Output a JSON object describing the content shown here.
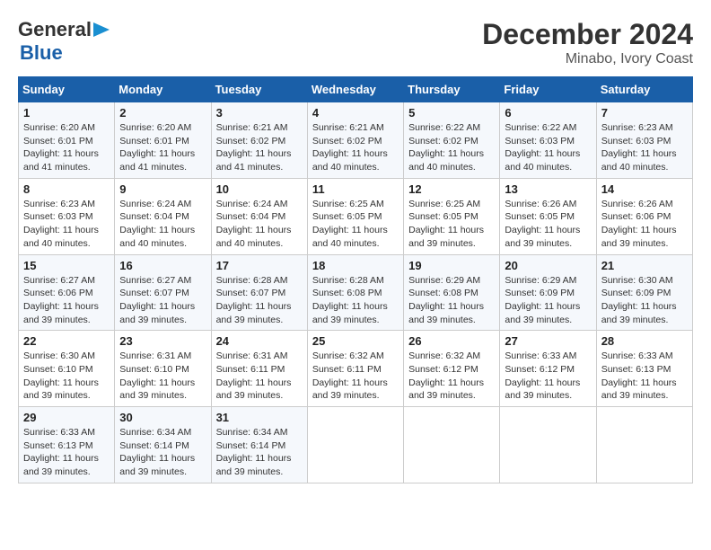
{
  "header": {
    "logo_line1": "General",
    "logo_line2": "Blue",
    "title": "December 2024",
    "subtitle": "Minabo, Ivory Coast"
  },
  "weekdays": [
    "Sunday",
    "Monday",
    "Tuesday",
    "Wednesday",
    "Thursday",
    "Friday",
    "Saturday"
  ],
  "weeks": [
    [
      {
        "day": "1",
        "sunrise": "6:20 AM",
        "sunset": "6:01 PM",
        "daylight": "11 hours and 41 minutes."
      },
      {
        "day": "2",
        "sunrise": "6:20 AM",
        "sunset": "6:01 PM",
        "daylight": "11 hours and 41 minutes."
      },
      {
        "day": "3",
        "sunrise": "6:21 AM",
        "sunset": "6:02 PM",
        "daylight": "11 hours and 41 minutes."
      },
      {
        "day": "4",
        "sunrise": "6:21 AM",
        "sunset": "6:02 PM",
        "daylight": "11 hours and 40 minutes."
      },
      {
        "day": "5",
        "sunrise": "6:22 AM",
        "sunset": "6:02 PM",
        "daylight": "11 hours and 40 minutes."
      },
      {
        "day": "6",
        "sunrise": "6:22 AM",
        "sunset": "6:03 PM",
        "daylight": "11 hours and 40 minutes."
      },
      {
        "day": "7",
        "sunrise": "6:23 AM",
        "sunset": "6:03 PM",
        "daylight": "11 hours and 40 minutes."
      }
    ],
    [
      {
        "day": "8",
        "sunrise": "6:23 AM",
        "sunset": "6:03 PM",
        "daylight": "11 hours and 40 minutes."
      },
      {
        "day": "9",
        "sunrise": "6:24 AM",
        "sunset": "6:04 PM",
        "daylight": "11 hours and 40 minutes."
      },
      {
        "day": "10",
        "sunrise": "6:24 AM",
        "sunset": "6:04 PM",
        "daylight": "11 hours and 40 minutes."
      },
      {
        "day": "11",
        "sunrise": "6:25 AM",
        "sunset": "6:05 PM",
        "daylight": "11 hours and 40 minutes."
      },
      {
        "day": "12",
        "sunrise": "6:25 AM",
        "sunset": "6:05 PM",
        "daylight": "11 hours and 39 minutes."
      },
      {
        "day": "13",
        "sunrise": "6:26 AM",
        "sunset": "6:05 PM",
        "daylight": "11 hours and 39 minutes."
      },
      {
        "day": "14",
        "sunrise": "6:26 AM",
        "sunset": "6:06 PM",
        "daylight": "11 hours and 39 minutes."
      }
    ],
    [
      {
        "day": "15",
        "sunrise": "6:27 AM",
        "sunset": "6:06 PM",
        "daylight": "11 hours and 39 minutes."
      },
      {
        "day": "16",
        "sunrise": "6:27 AM",
        "sunset": "6:07 PM",
        "daylight": "11 hours and 39 minutes."
      },
      {
        "day": "17",
        "sunrise": "6:28 AM",
        "sunset": "6:07 PM",
        "daylight": "11 hours and 39 minutes."
      },
      {
        "day": "18",
        "sunrise": "6:28 AM",
        "sunset": "6:08 PM",
        "daylight": "11 hours and 39 minutes."
      },
      {
        "day": "19",
        "sunrise": "6:29 AM",
        "sunset": "6:08 PM",
        "daylight": "11 hours and 39 minutes."
      },
      {
        "day": "20",
        "sunrise": "6:29 AM",
        "sunset": "6:09 PM",
        "daylight": "11 hours and 39 minutes."
      },
      {
        "day": "21",
        "sunrise": "6:30 AM",
        "sunset": "6:09 PM",
        "daylight": "11 hours and 39 minutes."
      }
    ],
    [
      {
        "day": "22",
        "sunrise": "6:30 AM",
        "sunset": "6:10 PM",
        "daylight": "11 hours and 39 minutes."
      },
      {
        "day": "23",
        "sunrise": "6:31 AM",
        "sunset": "6:10 PM",
        "daylight": "11 hours and 39 minutes."
      },
      {
        "day": "24",
        "sunrise": "6:31 AM",
        "sunset": "6:11 PM",
        "daylight": "11 hours and 39 minutes."
      },
      {
        "day": "25",
        "sunrise": "6:32 AM",
        "sunset": "6:11 PM",
        "daylight": "11 hours and 39 minutes."
      },
      {
        "day": "26",
        "sunrise": "6:32 AM",
        "sunset": "6:12 PM",
        "daylight": "11 hours and 39 minutes."
      },
      {
        "day": "27",
        "sunrise": "6:33 AM",
        "sunset": "6:12 PM",
        "daylight": "11 hours and 39 minutes."
      },
      {
        "day": "28",
        "sunrise": "6:33 AM",
        "sunset": "6:13 PM",
        "daylight": "11 hours and 39 minutes."
      }
    ],
    [
      {
        "day": "29",
        "sunrise": "6:33 AM",
        "sunset": "6:13 PM",
        "daylight": "11 hours and 39 minutes."
      },
      {
        "day": "30",
        "sunrise": "6:34 AM",
        "sunset": "6:14 PM",
        "daylight": "11 hours and 39 minutes."
      },
      {
        "day": "31",
        "sunrise": "6:34 AM",
        "sunset": "6:14 PM",
        "daylight": "11 hours and 39 minutes."
      },
      null,
      null,
      null,
      null
    ]
  ]
}
